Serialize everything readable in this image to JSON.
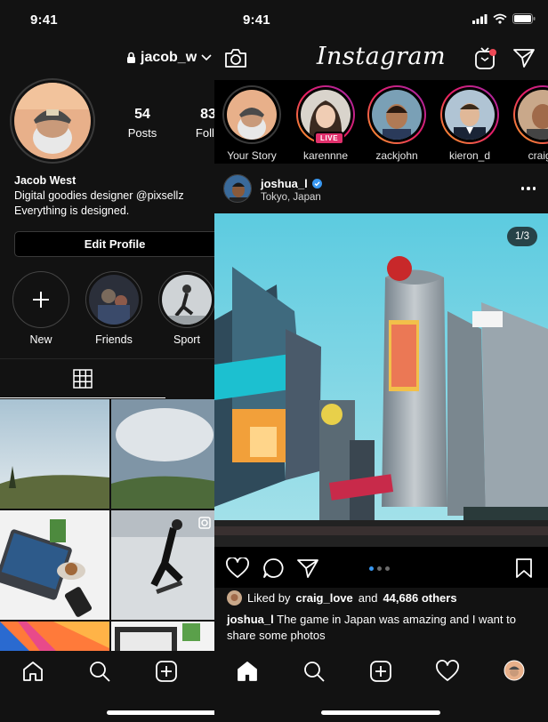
{
  "status": {
    "time": "9:41"
  },
  "profile": {
    "username": "jacob_w",
    "name": "Jacob West",
    "bio_line1": "Digital goodies designer @pixsellz",
    "bio_line2": "Everything is designed.",
    "stats": [
      {
        "value": "54",
        "label": "Posts"
      },
      {
        "value": "83",
        "label": "Follo"
      }
    ],
    "edit_profile_label": "Edit Profile",
    "highlights": [
      {
        "label": "New"
      },
      {
        "label": "Friends"
      },
      {
        "label": "Sport"
      }
    ]
  },
  "feed": {
    "logo": "Instagram",
    "stories": [
      {
        "label": "Your Story"
      },
      {
        "label": "karennne",
        "live": "LIVE"
      },
      {
        "label": "zackjohn"
      },
      {
        "label": "kieron_d"
      },
      {
        "label": "craig_"
      }
    ],
    "post": {
      "username": "joshua_l",
      "location": "Tokyo, Japan",
      "counter": "1/3",
      "liked_by_prefix": "Liked by",
      "liked_by_user": "craig_love",
      "liked_by_and": "and",
      "liked_by_count": "44,686 others",
      "caption_user": "joshua_l",
      "caption_text": "The game in Japan was amazing and I want to share some photos"
    }
  },
  "colors": {
    "accent_blue": "#3897f0",
    "live_pink": "#e1306c",
    "background": "#121212"
  },
  "icons": [
    "lock-icon",
    "chevron-down-icon",
    "plus-icon",
    "grid-icon",
    "camera-icon",
    "igtv-icon",
    "direct-icon",
    "verified-icon",
    "more-icon",
    "heart-icon",
    "comment-icon",
    "share-icon",
    "bookmark-icon",
    "home-icon",
    "search-icon",
    "add-post-icon",
    "activity-icon",
    "profile-avatar-icon",
    "signal-icon",
    "wifi-icon",
    "battery-icon",
    "multi-photo-icon"
  ]
}
